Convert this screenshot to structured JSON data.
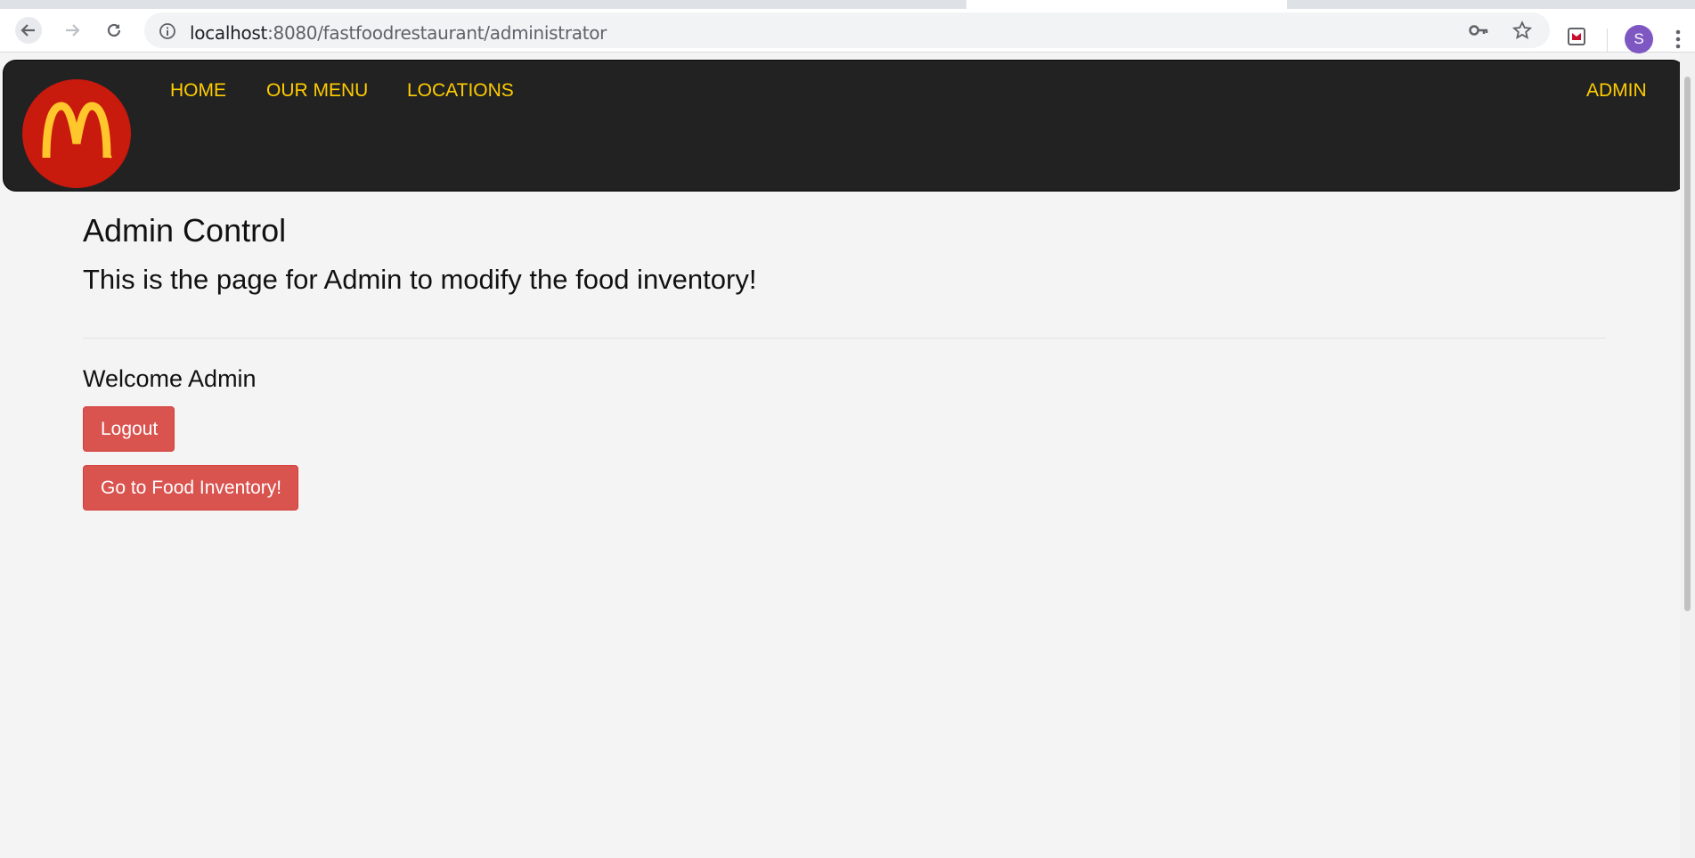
{
  "browser": {
    "url_host": "localhost",
    "url_path": ":8080/fastfoodrestaurant/administrator",
    "profile_initial": "S",
    "icons": [
      "back-arrow-icon",
      "forward-arrow-icon",
      "reload-icon",
      "info-icon",
      "key-icon",
      "star-icon",
      "extension-icon",
      "more-vert-icon"
    ]
  },
  "navbar": {
    "logo_icon": "golden-arches-logo",
    "logo_color": "#c81a0d",
    "link_color": "#ffcc00",
    "links": [
      {
        "label": "HOME"
      },
      {
        "label": "OUR MENU"
      },
      {
        "label": "LOCATIONS"
      }
    ],
    "admin_label": "ADMIN"
  },
  "main": {
    "title": "Admin Control",
    "subtitle": "This is the page for Admin to modify the food inventory!",
    "welcome": "Welcome Admin",
    "logout_label": "Logout",
    "inventory_label": "Go to Food Inventory!",
    "button_color": "#d9534f"
  }
}
